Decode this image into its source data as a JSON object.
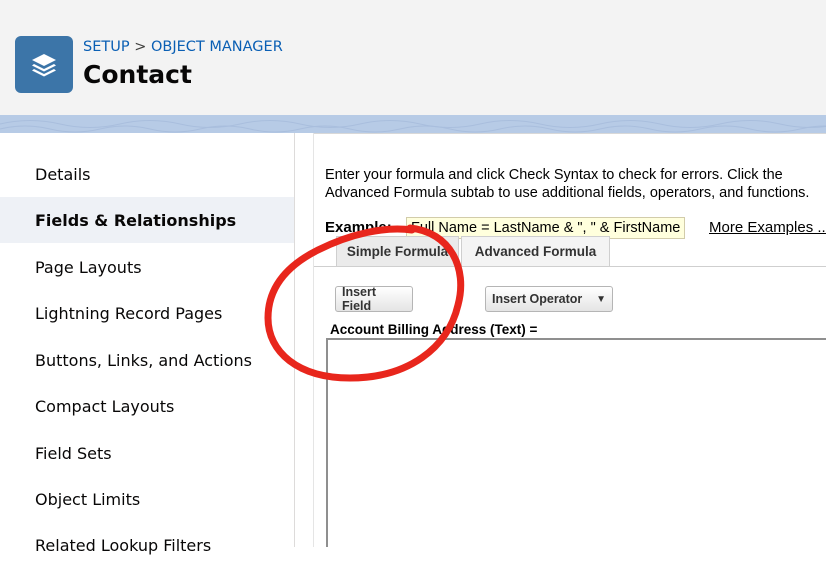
{
  "header": {
    "breadcrumb_setup": "SETUP",
    "breadcrumb_separator": ">",
    "breadcrumb_object_manager": "OBJECT MANAGER",
    "title": "Contact",
    "app_icon": "layers-icon"
  },
  "sidebar": {
    "items": [
      {
        "label": "Details"
      },
      {
        "label": "Fields & Relationships",
        "active": true
      },
      {
        "label": "Page Layouts"
      },
      {
        "label": "Lightning Record Pages"
      },
      {
        "label": "Buttons, Links, and Actions"
      },
      {
        "label": "Compact Layouts"
      },
      {
        "label": "Field Sets"
      },
      {
        "label": "Object Limits"
      },
      {
        "label": "Related Lookup Filters"
      }
    ]
  },
  "formula": {
    "intro_line1": "Enter your formula and click Check Syntax to check for errors. Click the",
    "intro_line2": "Advanced Formula subtab to use additional fields, operators, and functions.",
    "example_label": "Example:",
    "example_value": "Full Name = LastName & \", \" & FirstName",
    "more_examples": "More Examples ...",
    "tabs": [
      {
        "label": "Simple Formula"
      },
      {
        "label": "Advanced Formula",
        "active": true
      }
    ],
    "insert_field_label": "Insert Field",
    "insert_operator_label": "Insert Operator",
    "field_label": "Account Billing Address (Text) =",
    "formula_value": ""
  },
  "colors": {
    "accent": "#3c75a8",
    "link": "#0a5fb4",
    "annotation": "#e8261c"
  }
}
